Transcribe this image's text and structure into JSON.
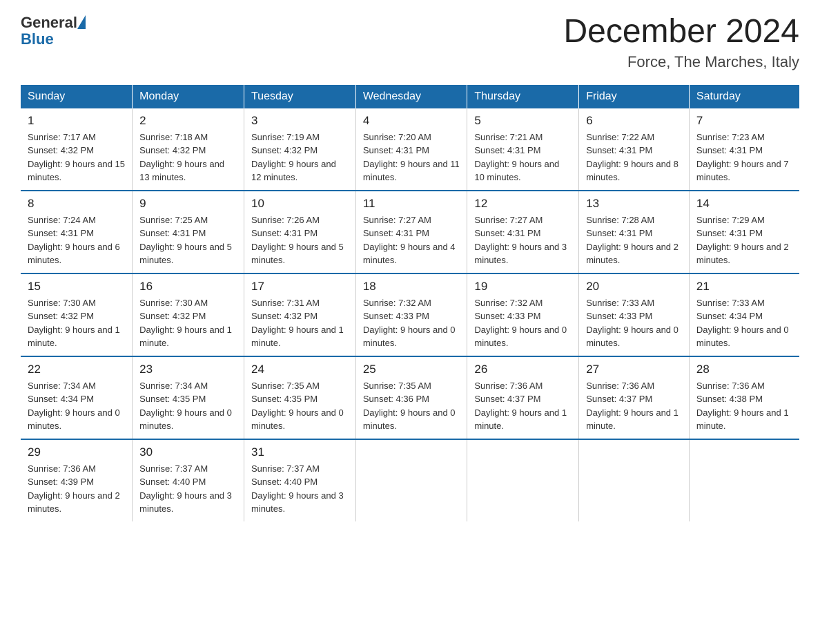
{
  "logo": {
    "general": "General",
    "blue": "Blue"
  },
  "header": {
    "month": "December 2024",
    "location": "Force, The Marches, Italy"
  },
  "weekdays": [
    "Sunday",
    "Monday",
    "Tuesday",
    "Wednesday",
    "Thursday",
    "Friday",
    "Saturday"
  ],
  "weeks": [
    [
      {
        "day": "1",
        "sunrise": "7:17 AM",
        "sunset": "4:32 PM",
        "daylight": "9 hours and 15 minutes."
      },
      {
        "day": "2",
        "sunrise": "7:18 AM",
        "sunset": "4:32 PM",
        "daylight": "9 hours and 13 minutes."
      },
      {
        "day": "3",
        "sunrise": "7:19 AM",
        "sunset": "4:32 PM",
        "daylight": "9 hours and 12 minutes."
      },
      {
        "day": "4",
        "sunrise": "7:20 AM",
        "sunset": "4:31 PM",
        "daylight": "9 hours and 11 minutes."
      },
      {
        "day": "5",
        "sunrise": "7:21 AM",
        "sunset": "4:31 PM",
        "daylight": "9 hours and 10 minutes."
      },
      {
        "day": "6",
        "sunrise": "7:22 AM",
        "sunset": "4:31 PM",
        "daylight": "9 hours and 8 minutes."
      },
      {
        "day": "7",
        "sunrise": "7:23 AM",
        "sunset": "4:31 PM",
        "daylight": "9 hours and 7 minutes."
      }
    ],
    [
      {
        "day": "8",
        "sunrise": "7:24 AM",
        "sunset": "4:31 PM",
        "daylight": "9 hours and 6 minutes."
      },
      {
        "day": "9",
        "sunrise": "7:25 AM",
        "sunset": "4:31 PM",
        "daylight": "9 hours and 5 minutes."
      },
      {
        "day": "10",
        "sunrise": "7:26 AM",
        "sunset": "4:31 PM",
        "daylight": "9 hours and 5 minutes."
      },
      {
        "day": "11",
        "sunrise": "7:27 AM",
        "sunset": "4:31 PM",
        "daylight": "9 hours and 4 minutes."
      },
      {
        "day": "12",
        "sunrise": "7:27 AM",
        "sunset": "4:31 PM",
        "daylight": "9 hours and 3 minutes."
      },
      {
        "day": "13",
        "sunrise": "7:28 AM",
        "sunset": "4:31 PM",
        "daylight": "9 hours and 2 minutes."
      },
      {
        "day": "14",
        "sunrise": "7:29 AM",
        "sunset": "4:31 PM",
        "daylight": "9 hours and 2 minutes."
      }
    ],
    [
      {
        "day": "15",
        "sunrise": "7:30 AM",
        "sunset": "4:32 PM",
        "daylight": "9 hours and 1 minute."
      },
      {
        "day": "16",
        "sunrise": "7:30 AM",
        "sunset": "4:32 PM",
        "daylight": "9 hours and 1 minute."
      },
      {
        "day": "17",
        "sunrise": "7:31 AM",
        "sunset": "4:32 PM",
        "daylight": "9 hours and 1 minute."
      },
      {
        "day": "18",
        "sunrise": "7:32 AM",
        "sunset": "4:33 PM",
        "daylight": "9 hours and 0 minutes."
      },
      {
        "day": "19",
        "sunrise": "7:32 AM",
        "sunset": "4:33 PM",
        "daylight": "9 hours and 0 minutes."
      },
      {
        "day": "20",
        "sunrise": "7:33 AM",
        "sunset": "4:33 PM",
        "daylight": "9 hours and 0 minutes."
      },
      {
        "day": "21",
        "sunrise": "7:33 AM",
        "sunset": "4:34 PM",
        "daylight": "9 hours and 0 minutes."
      }
    ],
    [
      {
        "day": "22",
        "sunrise": "7:34 AM",
        "sunset": "4:34 PM",
        "daylight": "9 hours and 0 minutes."
      },
      {
        "day": "23",
        "sunrise": "7:34 AM",
        "sunset": "4:35 PM",
        "daylight": "9 hours and 0 minutes."
      },
      {
        "day": "24",
        "sunrise": "7:35 AM",
        "sunset": "4:35 PM",
        "daylight": "9 hours and 0 minutes."
      },
      {
        "day": "25",
        "sunrise": "7:35 AM",
        "sunset": "4:36 PM",
        "daylight": "9 hours and 0 minutes."
      },
      {
        "day": "26",
        "sunrise": "7:36 AM",
        "sunset": "4:37 PM",
        "daylight": "9 hours and 1 minute."
      },
      {
        "day": "27",
        "sunrise": "7:36 AM",
        "sunset": "4:37 PM",
        "daylight": "9 hours and 1 minute."
      },
      {
        "day": "28",
        "sunrise": "7:36 AM",
        "sunset": "4:38 PM",
        "daylight": "9 hours and 1 minute."
      }
    ],
    [
      {
        "day": "29",
        "sunrise": "7:36 AM",
        "sunset": "4:39 PM",
        "daylight": "9 hours and 2 minutes."
      },
      {
        "day": "30",
        "sunrise": "7:37 AM",
        "sunset": "4:40 PM",
        "daylight": "9 hours and 3 minutes."
      },
      {
        "day": "31",
        "sunrise": "7:37 AM",
        "sunset": "4:40 PM",
        "daylight": "9 hours and 3 minutes."
      },
      null,
      null,
      null,
      null
    ]
  ]
}
